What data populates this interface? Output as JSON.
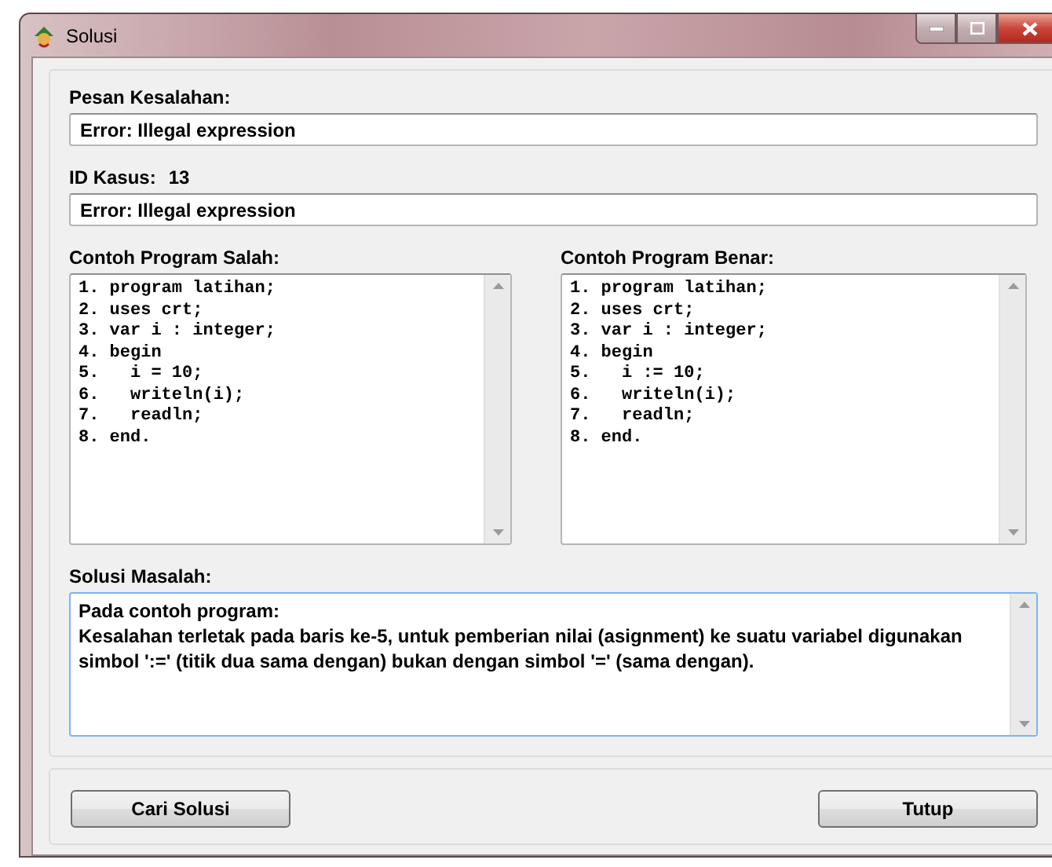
{
  "window": {
    "title": "Solusi"
  },
  "error_message": {
    "label": "Pesan Kesalahan:",
    "value": "Error: Illegal expression"
  },
  "case": {
    "label": "ID Kasus:",
    "id": "13",
    "value": "Error: Illegal expression"
  },
  "programs": [
    {
      "label": "Contoh Program Salah:",
      "lines": [
        "1. program latihan;",
        "2. uses crt;",
        "3. var i : integer;",
        "4. begin",
        "5.   i = 10;",
        "6.   writeln(i);",
        "7.   readln;",
        "8. end."
      ]
    },
    {
      "label": "Contoh Program Benar:",
      "lines": [
        "1. program latihan;",
        "2. uses crt;",
        "3. var i : integer;",
        "4. begin",
        "5.   i := 10;",
        "6.   writeln(i);",
        "7.   readln;",
        "8. end."
      ]
    }
  ],
  "solution": {
    "label": "Solusi Masalah:",
    "paragraphs": [
      "Pada contoh program:",
      "Kesalahan terletak pada baris ke-5, untuk pemberian nilai (asignment) ke suatu variabel digunakan simbol ':=' (titik dua sama dengan) bukan dengan simbol '=' (sama dengan)."
    ]
  },
  "buttons": [
    {
      "label": "Cari Solusi"
    },
    {
      "label": "Tutup"
    }
  ]
}
